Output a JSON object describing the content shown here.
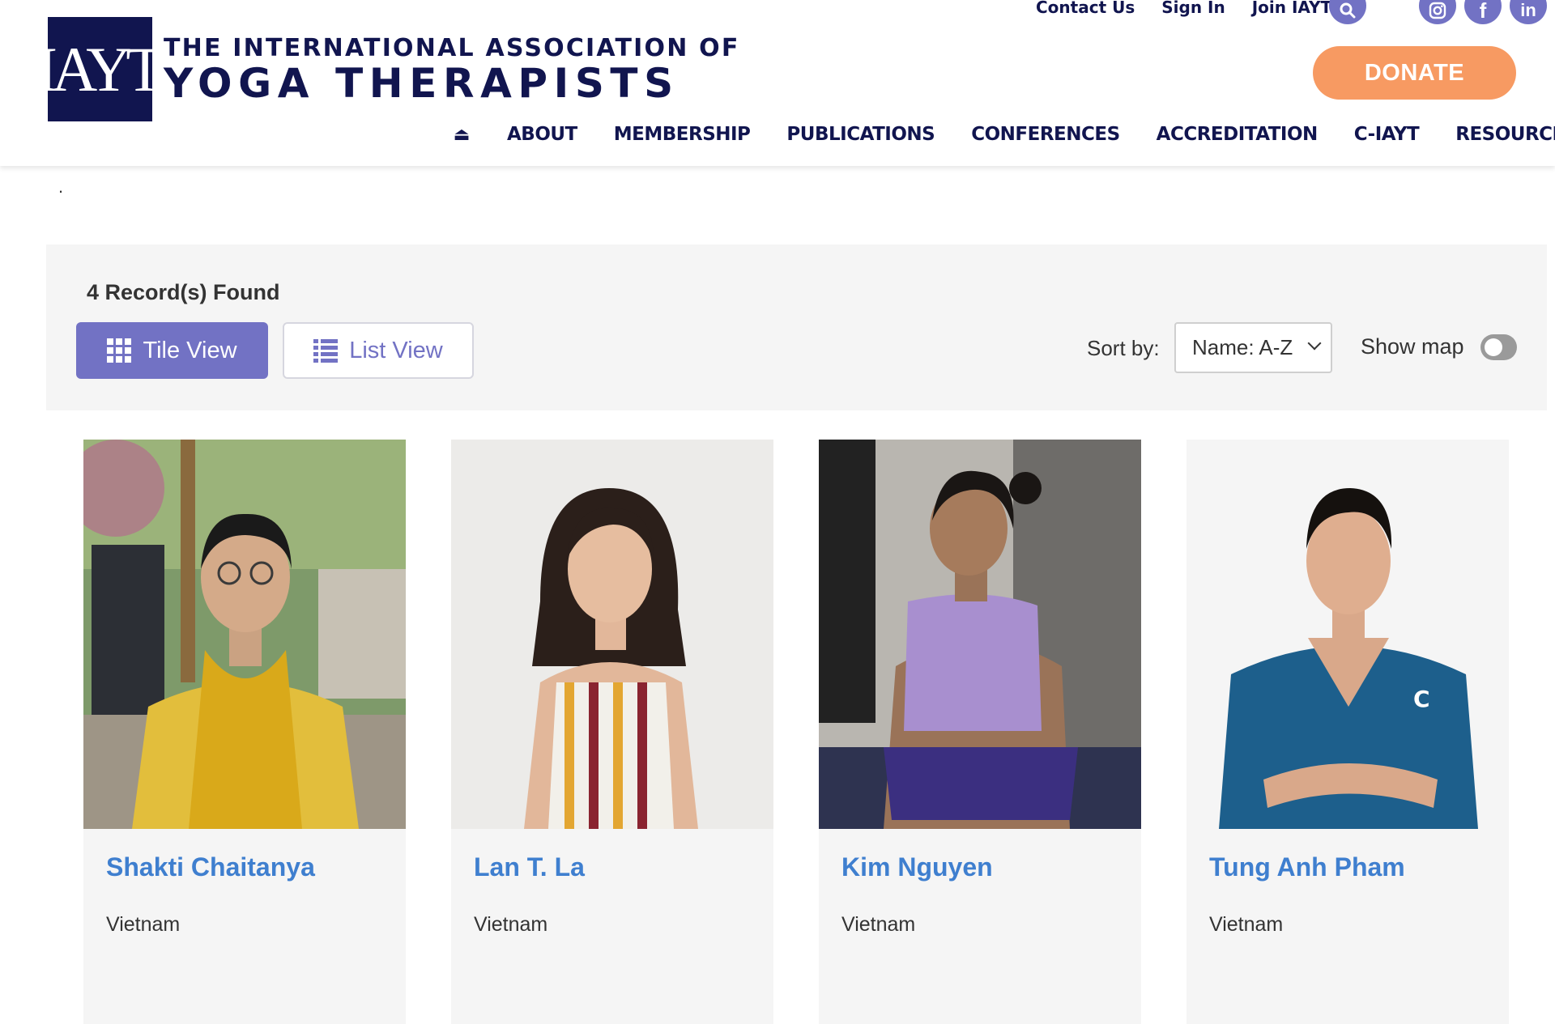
{
  "header": {
    "logo_mark": "IAYT",
    "logo_line1": "THE INTERNATIONAL ASSOCIATION OF",
    "logo_line2": "YOGA THERAPISTS",
    "util_links": [
      "Contact Us",
      "Sign In",
      "Join IAYT"
    ],
    "search_icon": "search-icon",
    "social": [
      "instagram-icon",
      "facebook-icon",
      "linkedin-icon"
    ],
    "social_glyphs": [
      "◎",
      "f",
      "in"
    ],
    "donate_label": "DONATE",
    "nav": [
      "ABOUT",
      "MEMBERSHIP",
      "PUBLICATIONS",
      "CONFERENCES",
      "ACCREDITATION",
      "C-IAYT",
      "RESOURCES"
    ],
    "home_glyph": "⏏"
  },
  "stray_mark": ".",
  "toolbar": {
    "records": "4 Record(s) Found",
    "tile_view": "Tile View",
    "list_view": "List View",
    "sort_label": "Sort by:",
    "sort_value": "Name: A-Z",
    "show_map": "Show map",
    "show_map_on": false
  },
  "colors": {
    "navy": "#11154f",
    "accent": "#7272c4",
    "donate": "#f79a62",
    "link": "#3f7fcf"
  },
  "cards": [
    {
      "name": "Shakti Chaitanya",
      "country": "Vietnam"
    },
    {
      "name": "Lan T. La",
      "country": "Vietnam"
    },
    {
      "name": "Kim Nguyen",
      "country": "Vietnam"
    },
    {
      "name": "Tung Anh Pham",
      "country": "Vietnam"
    }
  ]
}
